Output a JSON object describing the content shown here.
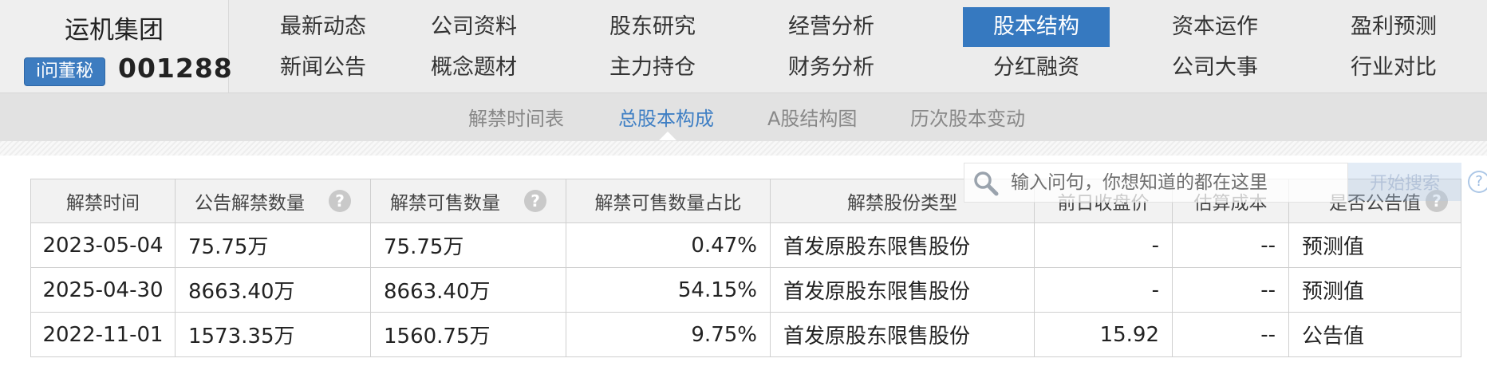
{
  "brand": {
    "company_name": "运机集团",
    "ask_badge": "i问董秘",
    "stock_code": "001288"
  },
  "nav": {
    "row1": [
      "最新动态",
      "公司资料",
      "股东研究",
      "经营分析",
      "股本结构",
      "资本运作",
      "盈利预测"
    ],
    "row2": [
      "新闻公告",
      "概念题材",
      "主力持仓",
      "财务分析",
      "分红融资",
      "公司大事",
      "行业对比"
    ],
    "active": "股本结构"
  },
  "subnav": {
    "items": [
      "解禁时间表",
      "总股本构成",
      "A股结构图",
      "历次股本变动"
    ],
    "active": "总股本构成"
  },
  "search": {
    "placeholder": "输入问句，你想知道的都在这里",
    "button_label": "开始搜索",
    "help_glyph": "?"
  },
  "table": {
    "headers": [
      "解禁时间",
      "公告解禁数量",
      "解禁可售数量",
      "解禁可售数量占比",
      "解禁股份类型",
      "前日收盘价",
      "估算成本",
      "是否公告值"
    ],
    "help_glyph": "?",
    "rows": [
      [
        "2023-05-04",
        "75.75万",
        "75.75万",
        "0.47%",
        "首发原股东限售股份",
        "-",
        "--",
        "预测值"
      ],
      [
        "2025-04-30",
        "8663.40万",
        "8663.40万",
        "54.15%",
        "首发原股东限售股份",
        "-",
        "--",
        "预测值"
      ],
      [
        "2022-11-01",
        "1573.35万",
        "1560.75万",
        "9.75%",
        "首发原股东限售股份",
        "15.92",
        "--",
        "公告值"
      ]
    ]
  },
  "colors": {
    "active_tab": "#3679c0",
    "active_subtab": "#3f7fc4",
    "nav_background": "#ececec"
  }
}
